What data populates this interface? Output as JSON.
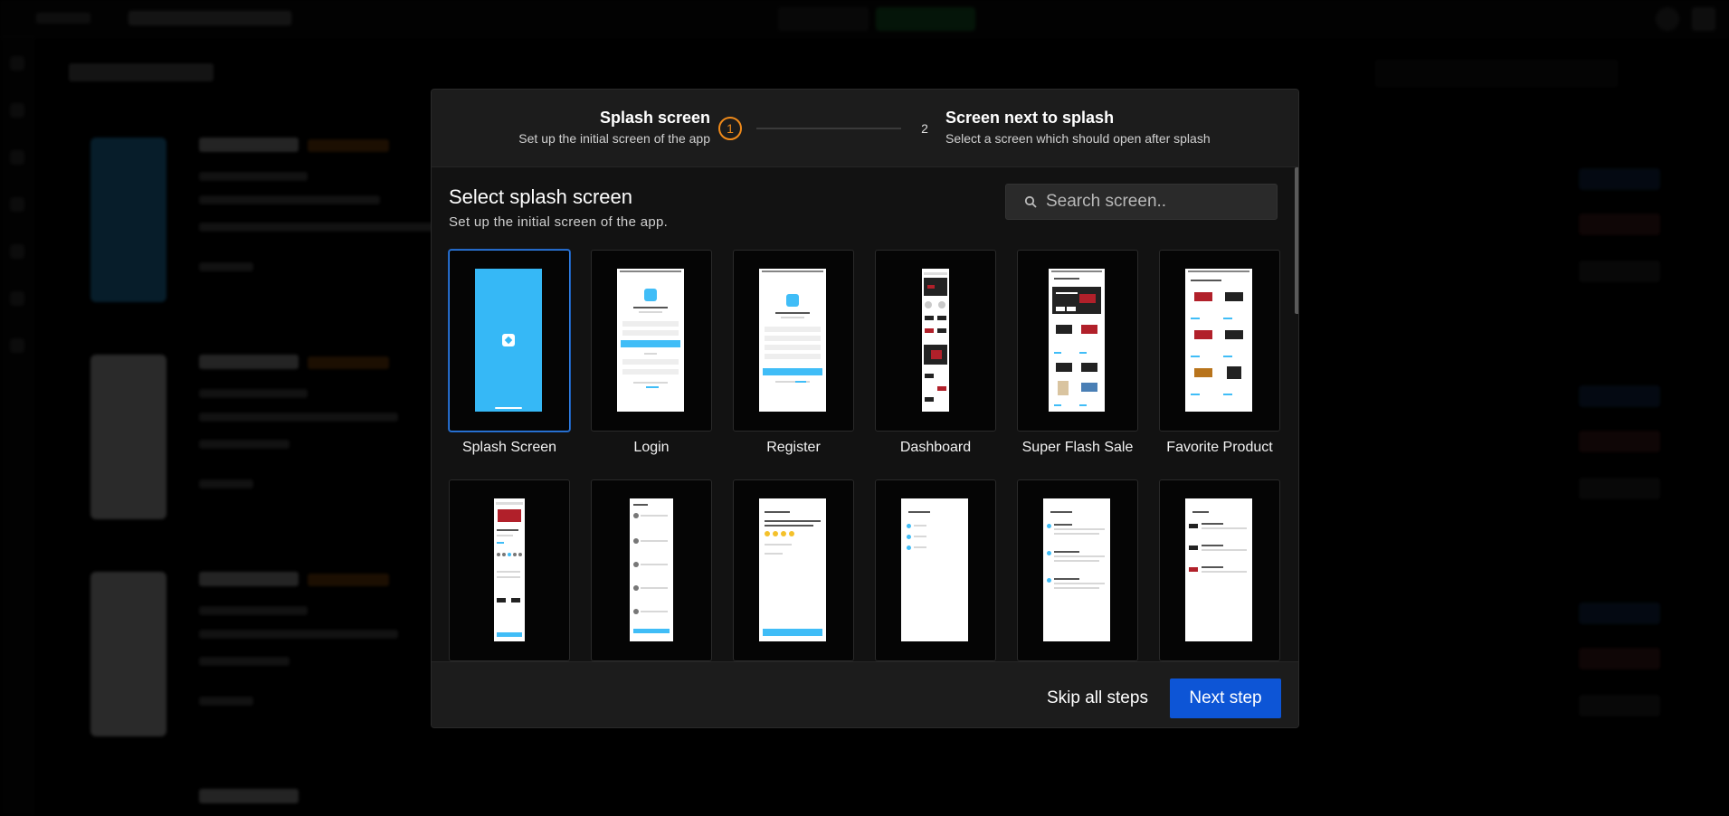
{
  "stepper": {
    "step1": {
      "number": "1",
      "title": "Splash screen",
      "subtitle": "Set up the initial screen of the app"
    },
    "step2": {
      "number": "2",
      "title": "Screen next to splash",
      "subtitle": "Select a screen which should open after splash"
    }
  },
  "section": {
    "title": "Select splash screen",
    "subtitle": "Set up the initial screen of the app."
  },
  "search": {
    "placeholder": "Search screen..",
    "icon": "search-icon"
  },
  "screens": [
    {
      "label": "Splash Screen",
      "selected": true
    },
    {
      "label": "Login"
    },
    {
      "label": "Register"
    },
    {
      "label": "Dashboard"
    },
    {
      "label": "Super Flash Sale"
    },
    {
      "label": "Favorite Product"
    }
  ],
  "footer": {
    "skip_label": "Skip all steps",
    "next_label": "Next step"
  },
  "colors": {
    "accent_blue": "#0d55d6",
    "step_active": "#f08a1a",
    "selected_border": "#2f7fe8",
    "splash_blue": "#36b8f6"
  }
}
